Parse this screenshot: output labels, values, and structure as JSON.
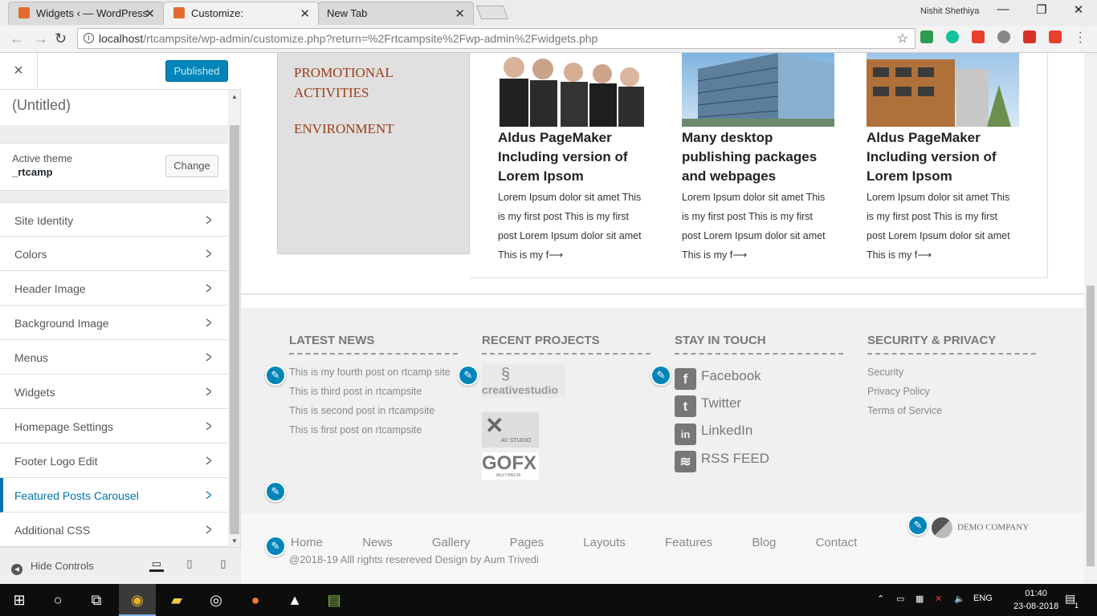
{
  "browser": {
    "tabs": [
      {
        "title": "Widgets ‹ — WordPress",
        "active": false
      },
      {
        "title": "Customize:",
        "active": true
      },
      {
        "title": "New Tab",
        "active": false
      }
    ],
    "user": "Nishit Shethiya",
    "url_host": "localhost",
    "url_path": "/rtcampsite/wp-admin/customize.php?return=%2Frtcampsite%2Fwp-admin%2Fwidgets.php"
  },
  "sidebar": {
    "close_icon": "×",
    "publish_label": "Published",
    "site_title": "(Untitled)",
    "theme_label": "Active theme",
    "theme_name": "_rtcamp",
    "change_label": "Change",
    "sections": [
      {
        "label": "Site Identity"
      },
      {
        "label": "Colors"
      },
      {
        "label": "Header Image"
      },
      {
        "label": "Background Image"
      },
      {
        "label": "Menus"
      },
      {
        "label": "Widgets"
      },
      {
        "label": "Homepage Settings"
      },
      {
        "label": "Footer Logo Edit"
      },
      {
        "label": "Featured Posts Carousel",
        "active": true
      },
      {
        "label": "Additional CSS"
      }
    ],
    "hide_controls": "Hide Controls",
    "accent": "#0073aa"
  },
  "preview": {
    "categories": [
      "PROMOTIONAL ACTIVITIES",
      "ENVIRONMENT"
    ],
    "posts": [
      {
        "title": "Aldus PageMaker Including version of Lorem Ipsom",
        "excerpt": "Lorem Ipsum dolor sit amet This is my first post This is my first post Lorem Ipsum dolor sit amet This is my f⟶"
      },
      {
        "title": "Many desktop publishing packages and webpages",
        "excerpt": "Lorem Ipsum dolor sit amet This is my first post This is my first post Lorem Ipsum dolor sit amet This is my f⟶"
      },
      {
        "title": "Aldus PageMaker Including version of Lorem Ipsom",
        "excerpt": "Lorem Ipsum dolor sit amet This is my first post This is my first post Lorem Ipsum dolor sit amet This is my f⟶"
      }
    ],
    "footer": {
      "latest_news": {
        "heading": "LATEST NEWS",
        "items": [
          "This is my fourth post on rtcamp site",
          "This is third post in rtcampsite",
          "This is second post in rtcampsite",
          "This is first post on rtcampsite"
        ]
      },
      "recent_projects": {
        "heading": "RECENT PROJECTS",
        "logos": [
          "creativestudio",
          "AV STUDIO",
          "GOFX",
          "MULTIMEDIA"
        ]
      },
      "stay_in_touch": {
        "heading": "STAY IN TOUCH",
        "items": [
          {
            "label": "Facebook",
            "glyph": "f"
          },
          {
            "label": "Twitter",
            "glyph": "t"
          },
          {
            "label": "LinkedIn",
            "glyph": "in"
          },
          {
            "label": "RSS FEED",
            "glyph": "≋"
          }
        ]
      },
      "security": {
        "heading": "SECURITY & PRIVACY",
        "items": [
          "Security",
          "Privacy Policy",
          "Terms of Service"
        ]
      },
      "nav": [
        "Home",
        "News",
        "Gallery",
        "Pages",
        "Layouts",
        "Features",
        "Blog",
        "Contact"
      ],
      "copyright": "@2018-19 Alll rights resereved Design by Aum Trivedi",
      "demo_company": "DEMO COMPANY"
    }
  },
  "taskbar": {
    "lang": "ENG",
    "time": "01:40",
    "date": "23-08-2018",
    "notifications": "1"
  }
}
